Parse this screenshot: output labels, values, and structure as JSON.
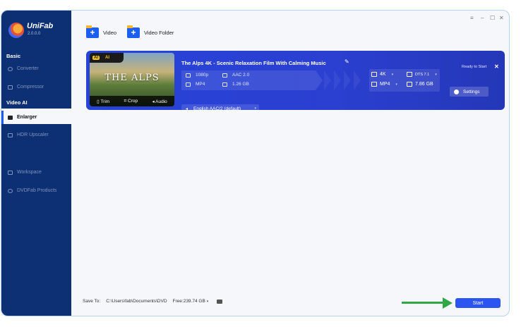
{
  "app": {
    "name": "UniFab",
    "version": "2.0.0.0"
  },
  "window_controls": [
    "≡",
    "–",
    "☐",
    "✕"
  ],
  "sidebar": {
    "sections": [
      {
        "label": "Basic"
      },
      {
        "label": "Video AI"
      }
    ],
    "items": [
      {
        "label": "Converter"
      },
      {
        "label": "Compressor"
      },
      {
        "label": "Enlarger"
      },
      {
        "label": "HDR Upscaler"
      },
      {
        "label": "Workspace"
      },
      {
        "label": "DVDFab Products"
      }
    ],
    "active": "Enlarger"
  },
  "toolbar": {
    "add_video_label": "Video",
    "add_folder_label": "Video Folder"
  },
  "task": {
    "title": "The Alps 4K - Scenic Relaxation Film With Calming Music",
    "thumbnail_text": "THE ALPS",
    "badges": [
      "AI",
      "AI"
    ],
    "thumb_actions": [
      "Trim",
      "Crop",
      "Audio"
    ],
    "status": "Ready to Start",
    "source": {
      "resolution": "1080p",
      "audio_codec": "AAC 2.0",
      "container": "MP4",
      "size": "1.26 GB"
    },
    "output": {
      "resolution": "4K",
      "container": "MP4",
      "audio": "DTS 7.1",
      "size": "7.86 GB"
    },
    "settings_label": "Settings",
    "audio_track": "English AAC/2 (default)"
  },
  "footer": {
    "save_to_label": "Save To:",
    "path": "C:\\Users\\fab\\Documents\\DVD",
    "free_space": "Free:239.74 GB",
    "start_label": "Start"
  },
  "colors": {
    "sidebar": "#0d2f73",
    "card": "#2743d8",
    "accent": "#2b55f0",
    "arrow": "#2fa745"
  }
}
